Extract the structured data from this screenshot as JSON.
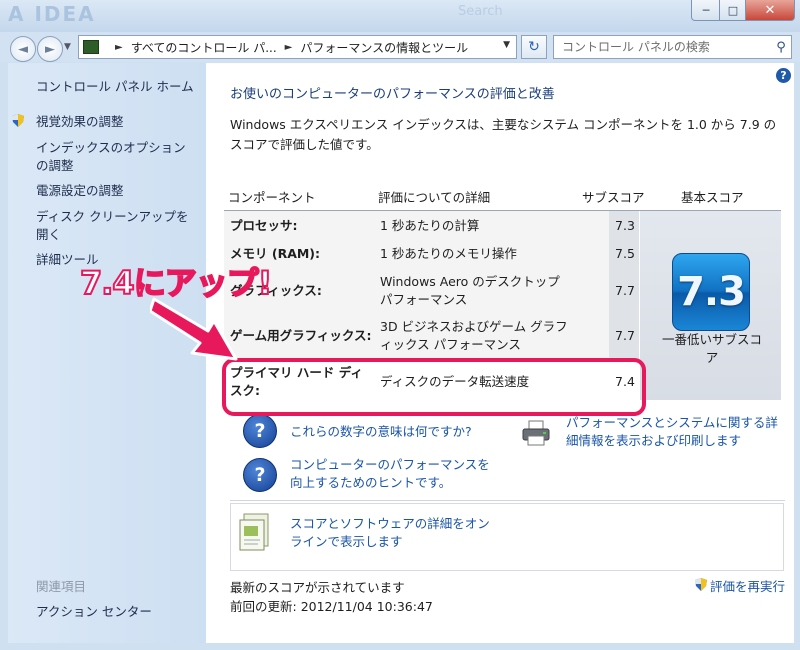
{
  "window": {
    "title_watermark": "A IDEA",
    "title_search_watermark": "Search",
    "minimize": "─",
    "maximize": "□",
    "close": "✕"
  },
  "address_bar": {
    "back": "◄",
    "forward": "►",
    "breadcrumbs": [
      "すべてのコントロール パ...",
      "パフォーマンスの情報とツール"
    ],
    "refresh": "↻",
    "search_placeholder": "コントロール パネルの検索"
  },
  "sidebar": {
    "home": "コントロール パネル ホーム",
    "items": [
      "視覚効果の調整",
      "インデックスのオプションの調整",
      "電源設定の調整",
      "ディスク クリーンアップを開く",
      "詳細ツール"
    ],
    "related_heading": "関連項目",
    "related_items": [
      "アクション センター"
    ]
  },
  "main": {
    "heading": "お使いのコンピューターのパフォーマンスの評価と改善",
    "description": "Windows エクスペリエンス インデックスは、主要なシステム コンポーネントを 1.0 から 7.9 のスコアで評価した値です。",
    "table": {
      "headers": [
        "コンポーネント",
        "評価についての詳細",
        "サブスコア",
        "基本スコア"
      ],
      "rows": [
        {
          "component": "プロセッサ:",
          "detail": "1 秒あたりの計算",
          "subscore": "7.3"
        },
        {
          "component": "メモリ (RAM):",
          "detail": "1 秒あたりのメモリ操作",
          "subscore": "7.5"
        },
        {
          "component": "グラフィックス:",
          "detail": "Windows Aero のデスクトップ パフォーマンス",
          "subscore": "7.7"
        },
        {
          "component": "ゲーム用グラフィックス:",
          "detail": "3D ビジネスおよびゲーム グラフィックス パフォーマンス",
          "subscore": "7.7"
        },
        {
          "component": "プライマリ ハード ディスク:",
          "detail": "ディスクのデータ転送速度",
          "subscore": "7.4"
        }
      ],
      "base_score": "7.3",
      "base_score_caption": "一番低いサブスコア"
    },
    "links": {
      "what_numbers_mean": "これらの数字の意味は何ですか?",
      "improve_tips": "コンピューターのパフォーマンスを向上するためのヒントです。",
      "print_details": "パフォーマンスとシステムに関する詳細情報を表示および印刷します",
      "software_details": "スコアとソフトウェアの詳細をオンラインで表示します",
      "rerun": "評価を再実行"
    },
    "status": {
      "latest": "最新のスコアが示されています",
      "last_updated_label": "前回の更新:",
      "last_updated_value": "2012/11/04 10:36:47"
    },
    "help": "?"
  },
  "annotation": {
    "text": "7.4にアップ!",
    "accent_color": "#e8185c"
  },
  "icons": {
    "help_glyph": "?",
    "search_glyph": "⚲"
  }
}
